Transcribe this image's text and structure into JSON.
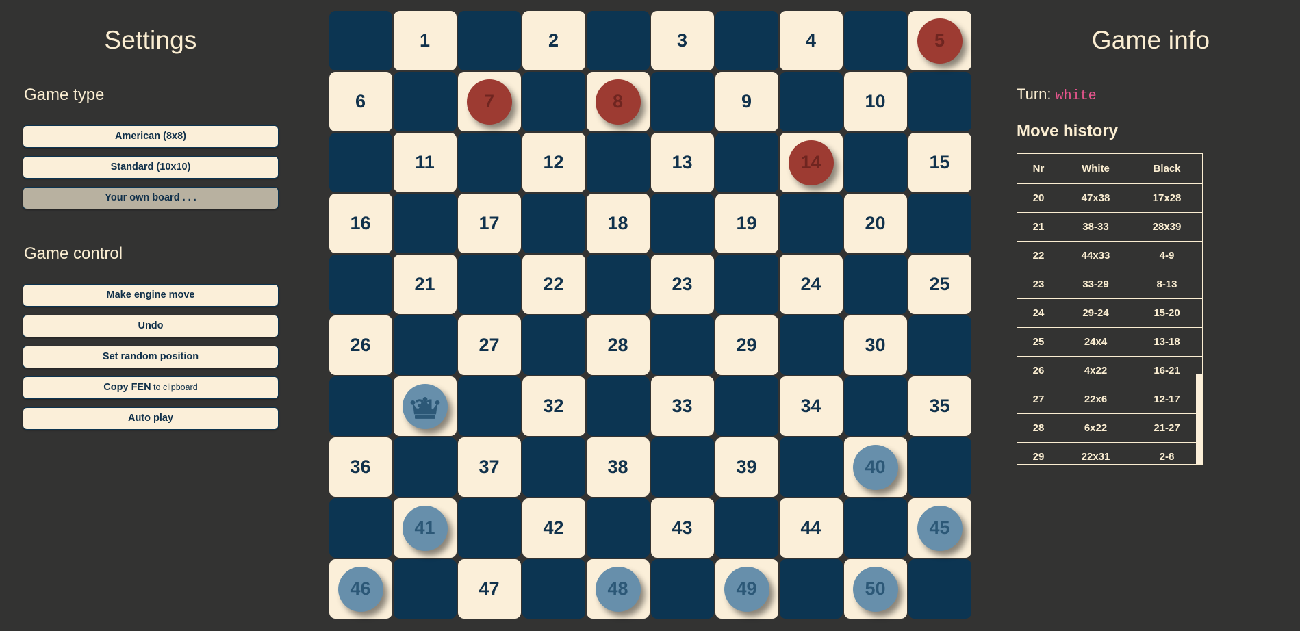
{
  "settings": {
    "title": "Settings",
    "game_type": {
      "heading": "Game type",
      "options": [
        {
          "label": "American (8x8)",
          "active": false
        },
        {
          "label": "Standard (10x10)",
          "active": false
        },
        {
          "label": "Your own board . . .",
          "active": true
        }
      ]
    },
    "game_control": {
      "heading": "Game control",
      "buttons": [
        {
          "label": "Make engine move",
          "sub": ""
        },
        {
          "label": "Undo",
          "sub": ""
        },
        {
          "label": "Set random position",
          "sub": ""
        },
        {
          "label": "Copy FEN",
          "sub": " to clipboard"
        },
        {
          "label": "Auto play",
          "sub": ""
        }
      ]
    }
  },
  "game_info": {
    "title": "Game info",
    "turn_label": "Turn:",
    "turn_value": "white",
    "move_history_title": "Move history",
    "columns": [
      "Nr",
      "White",
      "Black"
    ],
    "moves": [
      {
        "nr": "20",
        "white": "47x38",
        "black": "17x28"
      },
      {
        "nr": "21",
        "white": "38-33",
        "black": "28x39"
      },
      {
        "nr": "22",
        "white": "44x33",
        "black": "4-9"
      },
      {
        "nr": "23",
        "white": "33-29",
        "black": "8-13"
      },
      {
        "nr": "24",
        "white": "29-24",
        "black": "15-20"
      },
      {
        "nr": "25",
        "white": "24x4",
        "black": "13-18"
      },
      {
        "nr": "26",
        "white": "4x22",
        "black": "16-21"
      },
      {
        "nr": "27",
        "white": "22x6",
        "black": "12-17"
      },
      {
        "nr": "28",
        "white": "6x22",
        "black": "21-27"
      },
      {
        "nr": "29",
        "white": "22x31",
        "black": "2-8"
      }
    ]
  },
  "colors": {
    "background": "#333332",
    "light_square": "#fbefd9",
    "dark_square": "#0c3552",
    "red_piece": "#9d3b32",
    "white_piece": "#678fab",
    "accent_text": "#fbeed2",
    "turn_accent": "#e8558e",
    "active_button": "#b8b1a0"
  },
  "board": {
    "variant": "10x10",
    "rows": 10,
    "cols": 10,
    "square_count": 50,
    "numbers": [
      [
        null,
        "1",
        null,
        "2",
        null,
        "3",
        null,
        "4",
        null,
        "5"
      ],
      [
        "6",
        null,
        "7",
        null,
        "8",
        null,
        "9",
        null,
        "10",
        null
      ],
      [
        null,
        "11",
        null,
        "12",
        null,
        "13",
        null,
        "14",
        null,
        "15"
      ],
      [
        "16",
        null,
        "17",
        null,
        "18",
        null,
        "19",
        null,
        "20",
        null
      ],
      [
        null,
        "21",
        null,
        "22",
        null,
        "23",
        null,
        "24",
        null,
        "25"
      ],
      [
        "26",
        null,
        "27",
        null,
        "28",
        null,
        "29",
        null,
        "30",
        null
      ],
      [
        null,
        "31",
        null,
        "32",
        null,
        "33",
        null,
        "34",
        null,
        "35"
      ],
      [
        "36",
        null,
        "37",
        null,
        "38",
        null,
        "39",
        null,
        "40",
        null
      ],
      [
        null,
        "41",
        null,
        "42",
        null,
        "43",
        null,
        "44",
        null,
        "45"
      ],
      [
        "46",
        null,
        "47",
        null,
        "48",
        null,
        "49",
        null,
        "50",
        null
      ]
    ],
    "pieces": {
      "5": {
        "color": "red",
        "king": false
      },
      "7": {
        "color": "red",
        "king": false
      },
      "8": {
        "color": "red",
        "king": false
      },
      "14": {
        "color": "red",
        "king": false
      },
      "31": {
        "color": "white",
        "king": true
      },
      "40": {
        "color": "white",
        "king": false
      },
      "41": {
        "color": "white",
        "king": false
      },
      "45": {
        "color": "white",
        "king": false
      },
      "46": {
        "color": "white",
        "king": false
      },
      "48": {
        "color": "white",
        "king": false
      },
      "49": {
        "color": "white",
        "king": false
      },
      "50": {
        "color": "white",
        "king": false
      }
    }
  }
}
